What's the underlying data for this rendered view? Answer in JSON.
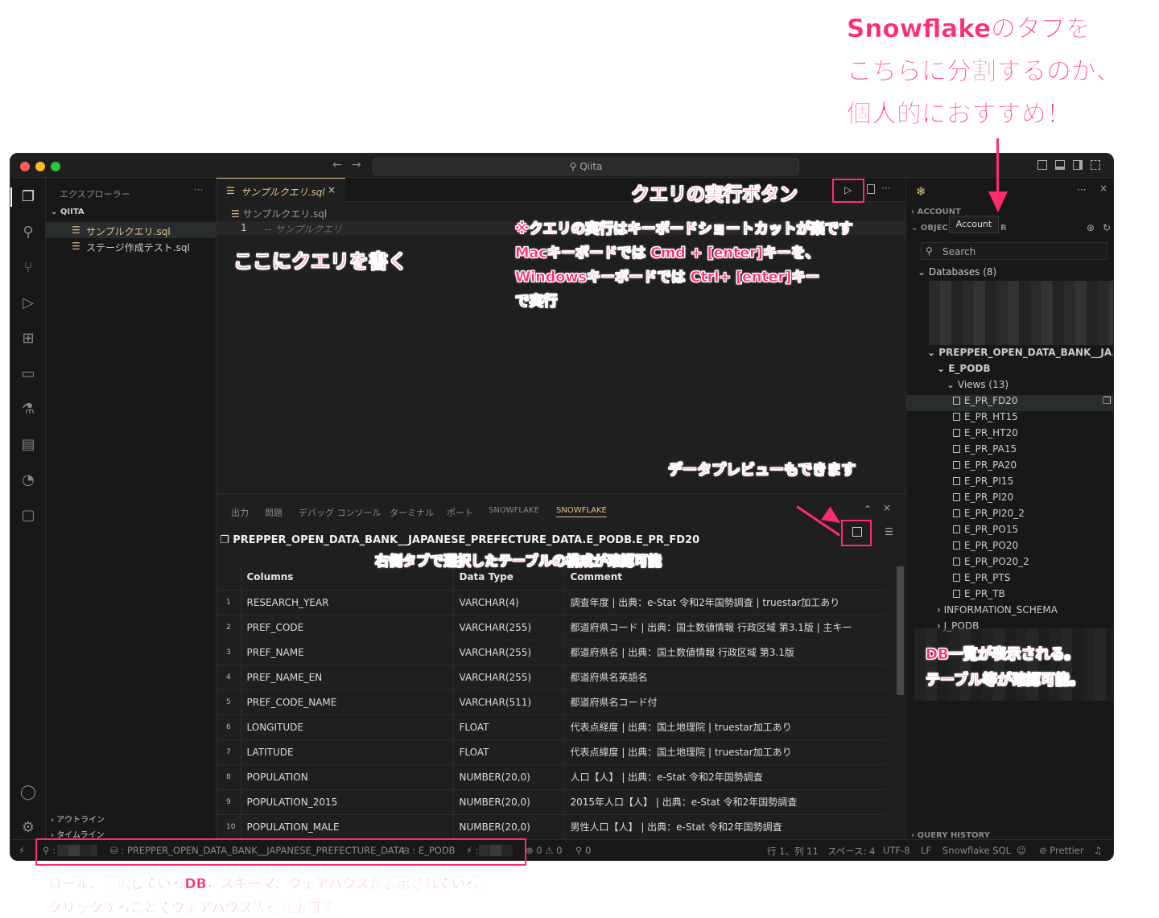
{
  "titlebar": {
    "search": "Qiita"
  },
  "explorer": {
    "header": "エクスプローラー",
    "folder": "QIITA",
    "files": [
      "サンプルクエリ.sql",
      "ステージ作成テスト.sql"
    ],
    "outline": "アウトライン",
    "timeline": "タイムライン"
  },
  "editor": {
    "tab": "サンプルクエリ.sql",
    "breadcrumb": "サンプルクエリ.sql",
    "line_number": "1",
    "line_text": "-- サンプルクエリ"
  },
  "panel": {
    "tabs": [
      "出力",
      "問題",
      "デバッグ コンソール",
      "ターミナル",
      "ポート",
      "SNOWFLAKE",
      "SNOWFLAKE"
    ],
    "table_title": "PREPPER_OPEN_DATA_BANK__JAPANESE_PREFECTURE_DATA.E_PODB.E_PR_FD20",
    "headers": [
      "Columns",
      "Data Type",
      "Comment"
    ],
    "rows": [
      {
        "n": "1",
        "col": "RESEARCH_YEAR",
        "type": "VARCHAR(4)",
        "comment": "調査年度 | 出典：e-Stat 令和2年国勢調査 | truestar加工あり"
      },
      {
        "n": "2",
        "col": "PREF_CODE",
        "type": "VARCHAR(255)",
        "comment": "都道府県コード | 出典：国土数値情報 行政区域 第3.1版 | 主キー"
      },
      {
        "n": "3",
        "col": "PREF_NAME",
        "type": "VARCHAR(255)",
        "comment": "都道府県名 | 出典：国土数値情報 行政区域 第3.1版"
      },
      {
        "n": "4",
        "col": "PREF_NAME_EN",
        "type": "VARCHAR(255)",
        "comment": "都道府県名英語名"
      },
      {
        "n": "5",
        "col": "PREF_CODE_NAME",
        "type": "VARCHAR(511)",
        "comment": "都道府県名コード付"
      },
      {
        "n": "6",
        "col": "LONGITUDE",
        "type": "FLOAT",
        "comment": "代表点経度 | 出典：国土地理院 | truestar加工あり"
      },
      {
        "n": "7",
        "col": "LATITUDE",
        "type": "FLOAT",
        "comment": "代表点緯度 | 出典：国土地理院 | truestar加工あり"
      },
      {
        "n": "8",
        "col": "POPULATION",
        "type": "NUMBER(20,0)",
        "comment": "人口【人】 | 出典：e-Stat 令和2年国勢調査"
      },
      {
        "n": "9",
        "col": "POPULATION_2015",
        "type": "NUMBER(20,0)",
        "comment": "2015年人口【人】 | 出典：e-Stat 令和2年国勢調査"
      },
      {
        "n": "10",
        "col": "POPULATION_MALE",
        "type": "NUMBER(20,0)",
        "comment": "男性人口【人】 | 出典：e-Stat 令和2年国勢調査"
      }
    ]
  },
  "right": {
    "account": "ACCOUNT",
    "objects": "OBJEC",
    "tooltip": "Account",
    "objects_tail": "R",
    "search": "Search",
    "databases": "Databases (8)",
    "db": "PREPPER_OPEN_DATA_BANK__JA...",
    "schema": "E_PODB",
    "views": "Views (13)",
    "view_items": [
      "E_PR_FD20",
      "E_PR_HT15",
      "E_PR_HT20",
      "E_PR_PA15",
      "E_PR_PA20",
      "E_PR_PI15",
      "E_PR_PI20",
      "E_PR_PI20_2",
      "E_PR_PO15",
      "E_PR_PO20",
      "E_PR_PO20_2",
      "E_PR_PTS",
      "E_PR_TB"
    ],
    "other_schemas": [
      "INFORMATION_SCHEMA",
      "J_PODB"
    ],
    "query_history": "QUERY HISTORY"
  },
  "status": {
    "db": "PREPPER_OPEN_DATA_BANK__JAPANESE_PREFECTURE_DATA",
    "schema": "E_PODB",
    "problems": "⊗ 0 ⚠ 0",
    "ports": "⚲ 0",
    "position": "行 1、列 11",
    "spaces": "スペース: 4",
    "encoding": "UTF-8",
    "eol": "LF",
    "language": "Snowflake SQL",
    "prettier": "Prettier"
  },
  "annotations": {
    "top_right": [
      "Snowflakeのタブを",
      "こちらに分割するのが、",
      "個人的におすすめ！"
    ],
    "run_button": "クエリの実行ボタン",
    "write_query": "ここにクエリを書く",
    "shortcut": [
      "※クエリの実行はキーボードショートカットが楽です",
      "Macキーボードでは Cmd + [enter]キーを、",
      "Windowsキーボードでは Ctrl+ [enter]キー",
      "で実行"
    ],
    "preview": "データプレビューもできます",
    "table_structure": "右側タブで選択したテーブルの構成が確認可能",
    "db_list": [
      "DB一覧が表示される。",
      "テーブル等が確認可能。"
    ],
    "bottom": [
      "ロール、選択しているDB，スキーマ、ウェアハウスが表示されている。",
      "クリックすることでウェアハウス等を変更可能。"
    ]
  },
  "colors": {
    "accent": "#ff2d6f",
    "snowflake_yellow": "#e2c08d",
    "bg": "#181818"
  }
}
